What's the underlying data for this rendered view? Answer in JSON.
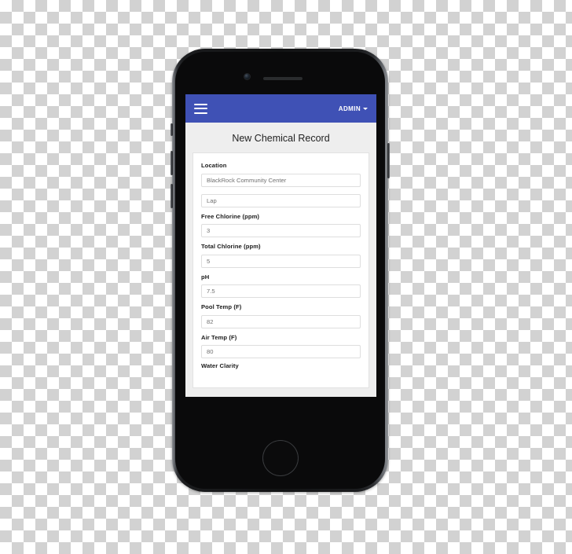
{
  "device": {
    "camera_icon": "front-camera",
    "earpiece_icon": "earpiece-speaker",
    "home_button_icon": "home-button"
  },
  "navbar": {
    "menu_icon": "hamburger-menu-icon",
    "account_label": "ADMIN",
    "caret_icon": "chevron-down-icon",
    "background_color": "#3f51b5"
  },
  "page": {
    "title": "New Chemical Record",
    "background_color": "#eeeeee",
    "card_background_color": "#ffffff"
  },
  "form": {
    "fields": [
      {
        "name": "location",
        "label": "Location",
        "value": "BlackRock Community Center",
        "placeholder": "Location"
      },
      {
        "name": "pool-area",
        "label": "",
        "value": "Lap",
        "placeholder": "Lap"
      },
      {
        "name": "free-chlorine",
        "label": "Free Chlorine (ppm)",
        "value": "3",
        "placeholder": "Free Chlorine (ppm)"
      },
      {
        "name": "total-chlorine",
        "label": "Total Chlorine (ppm)",
        "value": "5",
        "placeholder": "Total Chlorine (ppm)"
      },
      {
        "name": "ph",
        "label": "pH",
        "value": "7.5",
        "placeholder": "pH"
      },
      {
        "name": "pool-temp",
        "label": "Pool Temp (F)",
        "value": "82",
        "placeholder": "Pool Temp (F)"
      },
      {
        "name": "air-temp",
        "label": "Air Temp (F)",
        "value": "80",
        "placeholder": "Air Temp (F)"
      },
      {
        "name": "water-clarity",
        "label": "Water Clarity",
        "value": "",
        "placeholder": "Water Clarity"
      }
    ]
  }
}
